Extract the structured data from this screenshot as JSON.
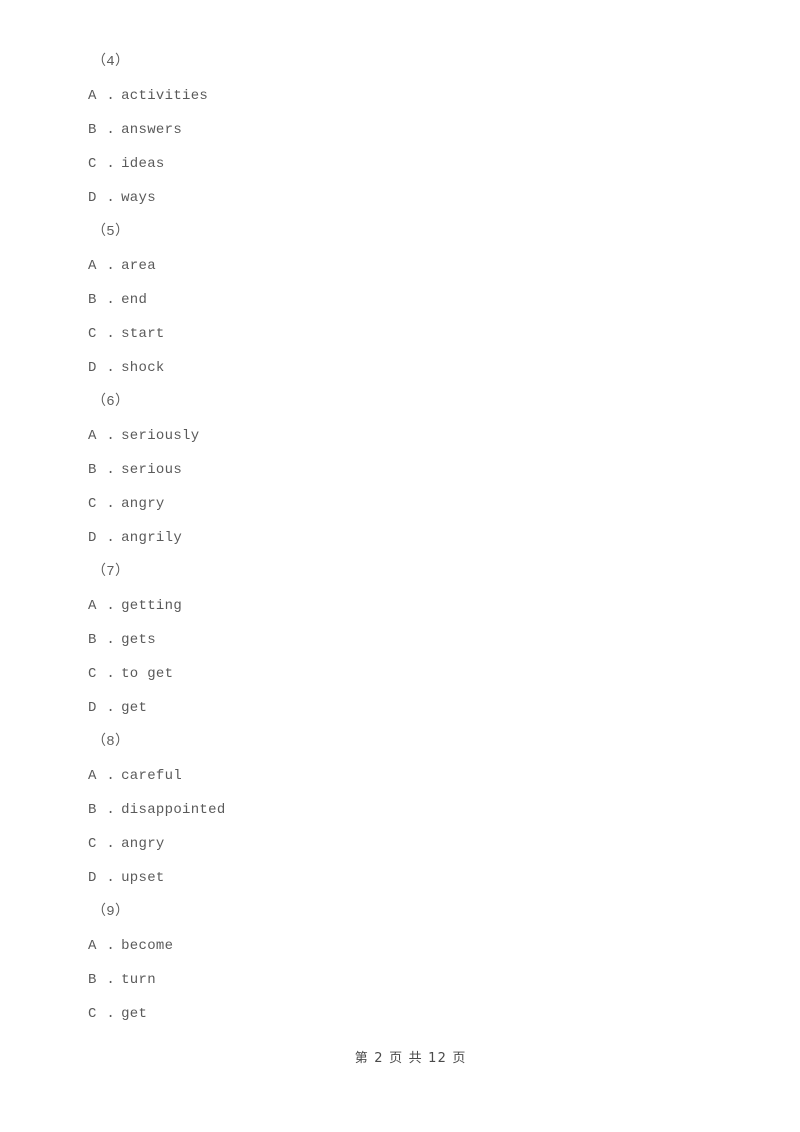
{
  "document": {
    "text_color": "#5a5a5a",
    "background_color": "#ffffff",
    "footer": {
      "page_label": "第 2 页 共 12 页"
    }
  },
  "questions": [
    {
      "number": "（4）",
      "options": [
        {
          "letter": "A",
          "separator": ".",
          "text": "activities"
        },
        {
          "letter": "B",
          "separator": ".",
          "text": "answers"
        },
        {
          "letter": "C",
          "separator": ".",
          "text": "ideas"
        },
        {
          "letter": "D",
          "separator": ".",
          "text": "ways"
        }
      ]
    },
    {
      "number": "（5）",
      "options": [
        {
          "letter": "A",
          "separator": ".",
          "text": "area"
        },
        {
          "letter": "B",
          "separator": ".",
          "text": "end"
        },
        {
          "letter": "C",
          "separator": ".",
          "text": "start"
        },
        {
          "letter": "D",
          "separator": ".",
          "text": "shock"
        }
      ]
    },
    {
      "number": "（6）",
      "options": [
        {
          "letter": "A",
          "separator": ".",
          "text": "seriously"
        },
        {
          "letter": "B",
          "separator": ".",
          "text": "serious"
        },
        {
          "letter": "C",
          "separator": ".",
          "text": "angry"
        },
        {
          "letter": "D",
          "separator": ".",
          "text": "angrily"
        }
      ]
    },
    {
      "number": "（7）",
      "options": [
        {
          "letter": "A",
          "separator": ".",
          "text": "getting"
        },
        {
          "letter": "B",
          "separator": ".",
          "text": "gets"
        },
        {
          "letter": "C",
          "separator": ".",
          "text": "to get"
        },
        {
          "letter": "D",
          "separator": ".",
          "text": "get"
        }
      ]
    },
    {
      "number": "（8）",
      "options": [
        {
          "letter": "A",
          "separator": ".",
          "text": "careful"
        },
        {
          "letter": "B",
          "separator": ".",
          "text": "disappointed"
        },
        {
          "letter": "C",
          "separator": ".",
          "text": "angry"
        },
        {
          "letter": "D",
          "separator": ".",
          "text": "upset"
        }
      ]
    },
    {
      "number": "（9）",
      "options": [
        {
          "letter": "A",
          "separator": ".",
          "text": "become"
        },
        {
          "letter": "B",
          "separator": ".",
          "text": "turn"
        },
        {
          "letter": "C",
          "separator": ".",
          "text": "get"
        }
      ]
    }
  ]
}
